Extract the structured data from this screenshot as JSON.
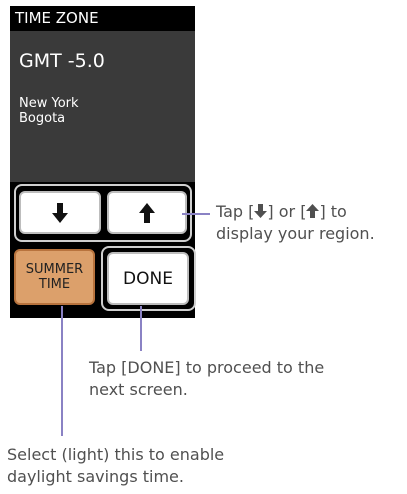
{
  "device": {
    "header": "TIME ZONE",
    "gmt": "GMT -5.0",
    "cities": [
      "New York",
      "Bogota"
    ],
    "summer_button": "SUMMER\nTIME",
    "done_button": "DONE"
  },
  "callouts": {
    "arrows": {
      "line1_pre": "Tap [",
      "line1_mid": "] or [",
      "line1_post": "] to",
      "line2": "display your region."
    },
    "done": {
      "line1": "Tap [DONE] to proceed to the",
      "line2": "next screen."
    },
    "summer": {
      "line1": "Select (light) this to enable",
      "line2": "daylight savings time."
    }
  },
  "colors": {
    "callout_line": "#8a82c4",
    "summer_bg": "#dca06b",
    "screen_bg": "#3a3a3a"
  },
  "icons": {
    "down": "arrow-down-icon",
    "up": "arrow-up-icon"
  }
}
